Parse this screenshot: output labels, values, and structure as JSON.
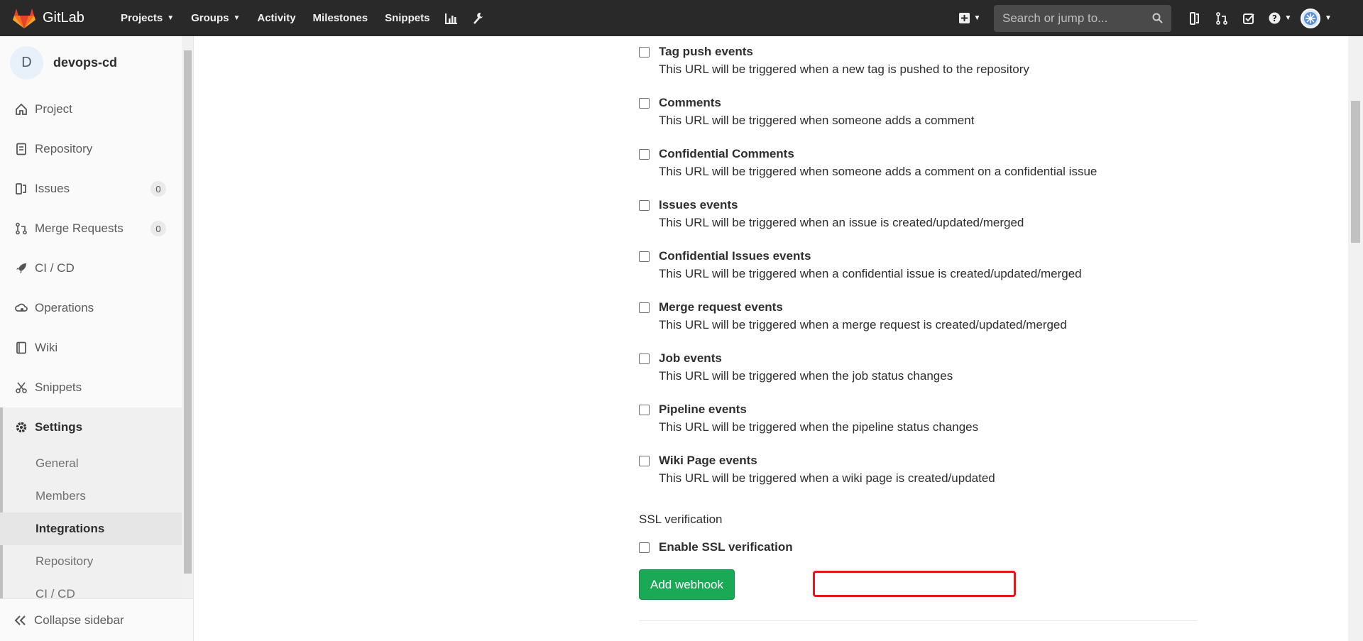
{
  "navbar": {
    "brand": "GitLab",
    "items": [
      {
        "label": "Projects",
        "caret": true
      },
      {
        "label": "Groups",
        "caret": true
      },
      {
        "label": "Activity"
      },
      {
        "label": "Milestones"
      },
      {
        "label": "Snippets"
      }
    ],
    "search_placeholder": "Search or jump to..."
  },
  "sidebar": {
    "project_initial": "D",
    "project_name": "devops-cd",
    "items": [
      {
        "label": "Project",
        "icon": "home-icon"
      },
      {
        "label": "Repository",
        "icon": "doc-icon"
      },
      {
        "label": "Issues",
        "icon": "issues-icon",
        "badge": "0"
      },
      {
        "label": "Merge Requests",
        "icon": "merge-icon",
        "badge": "0"
      },
      {
        "label": "CI / CD",
        "icon": "rocket-icon"
      },
      {
        "label": "Operations",
        "icon": "cloud-gear-icon"
      },
      {
        "label": "Wiki",
        "icon": "book-icon"
      },
      {
        "label": "Snippets",
        "icon": "scissors-icon"
      },
      {
        "label": "Settings",
        "icon": "gear-icon"
      }
    ],
    "settings_sub": [
      "General",
      "Members",
      "Integrations",
      "Repository",
      "CI / CD"
    ],
    "collapse_label": "Collapse sidebar"
  },
  "events": [
    {
      "title": "Tag push events",
      "desc": "This URL will be triggered when a new tag is pushed to the repository"
    },
    {
      "title": "Comments",
      "desc": "This URL will be triggered when someone adds a comment"
    },
    {
      "title": "Confidential Comments",
      "desc": "This URL will be triggered when someone adds a comment on a confidential issue"
    },
    {
      "title": "Issues events",
      "desc": "This URL will be triggered when an issue is created/updated/merged"
    },
    {
      "title": "Confidential Issues events",
      "desc": "This URL will be triggered when a confidential issue is created/updated/merged"
    },
    {
      "title": "Merge request events",
      "desc": "This URL will be triggered when a merge request is created/updated/merged"
    },
    {
      "title": "Job events",
      "desc": "This URL will be triggered when the job status changes"
    },
    {
      "title": "Pipeline events",
      "desc": "This URL will be triggered when the pipeline status changes"
    },
    {
      "title": "Wiki Page events",
      "desc": "This URL will be triggered when a wiki page is created/updated"
    }
  ],
  "ssl": {
    "section_label": "SSL verification",
    "checkbox_label": "Enable SSL verification"
  },
  "add_button": "Add webhook",
  "colors": {
    "accent": "#1aaa55",
    "highlight": "#e8161b",
    "navbar": "#292929"
  }
}
